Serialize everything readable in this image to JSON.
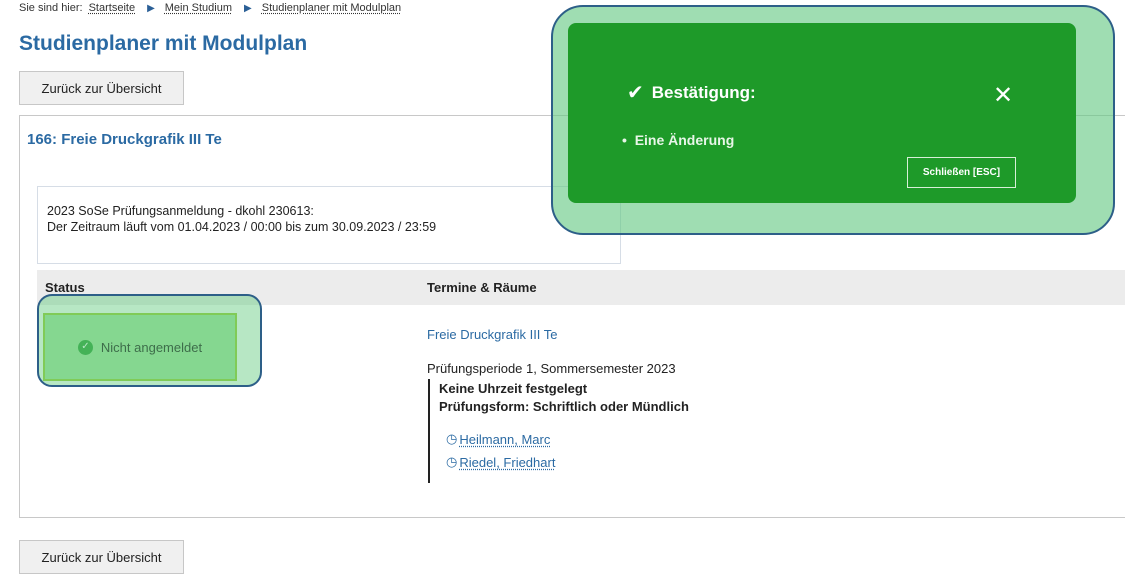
{
  "breadcrumb": {
    "prefix": "Sie sind hier:",
    "items": [
      "Startseite",
      "Mein Studium",
      "Studienplaner mit Modulplan"
    ]
  },
  "page_title": "Studienplaner mit Modulplan",
  "back_button_label": "Zurück zur Übersicht",
  "card": {
    "title": "166: Freie Druckgrafik III Te",
    "period": {
      "line1": "2023 SoSe Prüfungsanmeldung - dkohl 230613:",
      "line2": "Der Zeitraum läuft vom 01.04.2023 / 00:00 bis zum 30.09.2023 / 23:59"
    },
    "table": {
      "headers": [
        "Status",
        "Termine & Räume"
      ],
      "status": "Nicht angemeldet",
      "appointment": {
        "link": "Freie Druckgrafik III Te",
        "exam_period": "Prüfungsperiode 1, Sommersemester 2023",
        "time": "Keine Uhrzeit festgelegt",
        "form": "Prüfungsform: Schriftlich oder Mündlich",
        "examiners": [
          "Heilmann, Marc",
          "Riedel, Friedhart"
        ]
      }
    }
  },
  "toast": {
    "title": "Bestätigung:",
    "items": [
      "Eine Änderung"
    ],
    "close_button": "Schließen [ESC]",
    "color": "#1e9a29"
  },
  "colors": {
    "link": "#2b6aa3",
    "status_bg": "#a5e2a0",
    "status_border": "#9ccd3a"
  }
}
